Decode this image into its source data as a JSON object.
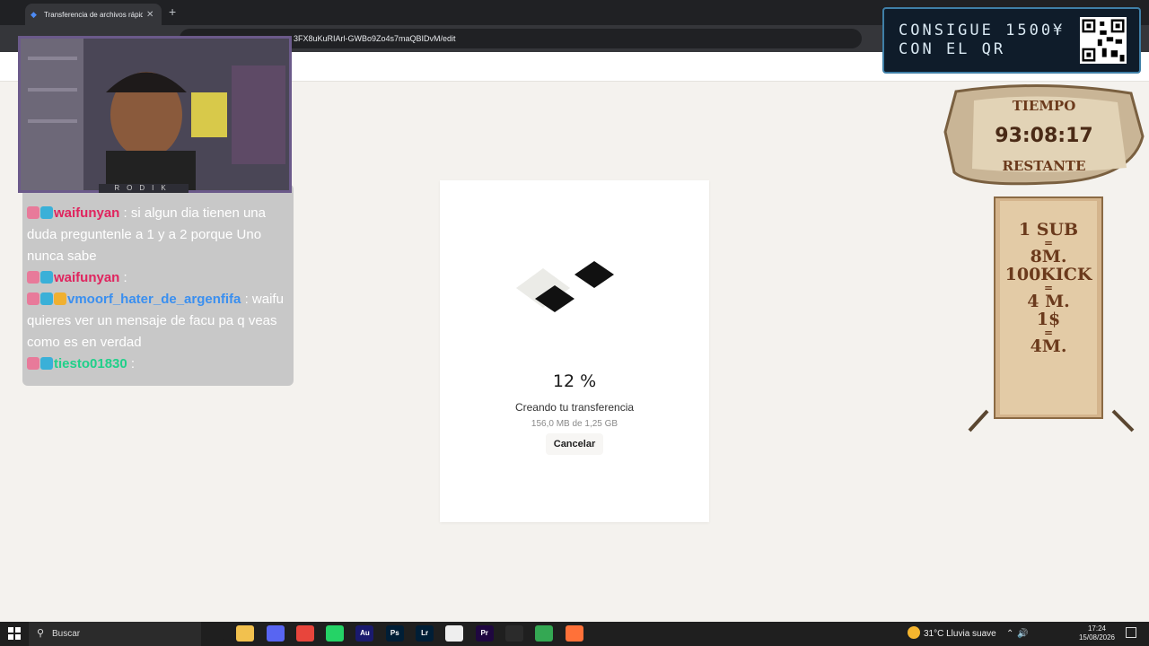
{
  "browser": {
    "tab_title": "Transferencia de archivos rápida",
    "url": "3FX8uKuRIArl-GWBo9Zo4s7maQBIDvM/edit"
  },
  "transfer": {
    "percent": "12 %",
    "status": "Creando tu transferencia",
    "size_progress": "156,0 MB de 1,25 GB",
    "cancel_label": "Cancelar",
    "progress_fraction": 0.12
  },
  "overlay": {
    "promo_line1": "CONSIGUE 1500¥",
    "promo_line2": "CON EL QR",
    "timer_top": "TIEMPO",
    "timer_value": "93:08:17",
    "timer_bottom": "RESTANTE",
    "scroll_lines": [
      "1 SUB",
      "=",
      "8M.",
      "100KICK",
      "=",
      "4 M.",
      "1$",
      "=",
      "4M."
    ],
    "webcam_name": "RODIK"
  },
  "chat": {
    "messages": [
      {
        "user": "waifunyan",
        "user_color": "#e0245e",
        "text": " : si algun dia tienen una duda preguntenle a 1 y a 2 porque Uno nunca sabe"
      },
      {
        "user": "waifunyan",
        "user_color": "#e0245e",
        "text": " : "
      },
      {
        "user": "vmoorf_hater_de_argenfifa",
        "user_color": "#3a8ff0",
        "text": " : waifu quieres ver un mensaje de facu pa q veas como es en verdad"
      },
      {
        "user": "tiesto01830",
        "user_color": "#20d08a",
        "text": " : "
      }
    ]
  },
  "taskbar": {
    "search_placeholder": "Buscar",
    "apps": [
      "task-view",
      "file-explorer",
      "discord",
      "chrome",
      "whatsapp",
      "audition",
      "photoshop",
      "lightroom",
      "capcut",
      "premiere",
      "obs",
      "chrome-active",
      "firefox"
    ],
    "app_labels": {
      "audition": "Au",
      "photoshop": "Ps",
      "lightroom": "Lr",
      "premiere": "Pr"
    },
    "temperature": "31°C",
    "weather": "Lluvia suave",
    "time": "17:24",
    "date": "15/08/2026"
  }
}
